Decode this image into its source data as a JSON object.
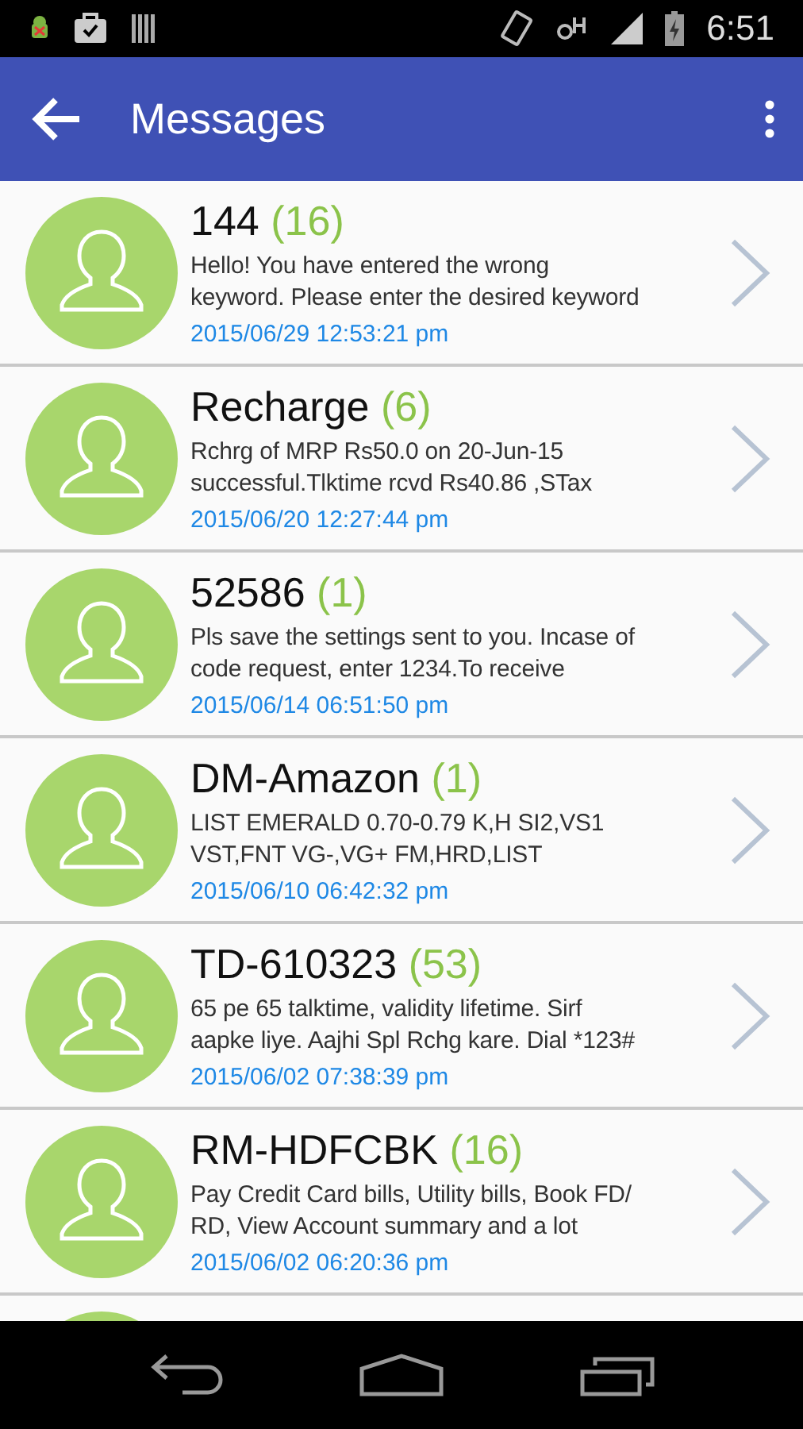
{
  "status_bar": {
    "time": "6:51"
  },
  "app_bar": {
    "title": "Messages"
  },
  "messages": [
    {
      "sender": "144",
      "count": "(16)",
      "preview": "Hello! You have entered the wrong\nkeyword. Please enter the desired keyword",
      "date": "2015/06/29 12:53:21 pm"
    },
    {
      "sender": "Recharge",
      "count": "(6)",
      "preview": "Rchrg of MRP Rs50.0 on 20-Jun-15\nsuccessful.Tlktime rcvd Rs40.86 ,STax",
      "date": "2015/06/20 12:27:44 pm"
    },
    {
      "sender": "52586",
      "count": "(1)",
      "preview": "Pls save the settings sent to you. Incase of\ncode request, enter 1234.To receive",
      "date": "2015/06/14 06:51:50 pm"
    },
    {
      "sender": "DM-Amazon",
      "count": "(1)",
      "preview": "LIST EMERALD 0.70-0.79 K,H SI2,VS1\nVST,FNT VG-,VG+ FM,HRD,LIST",
      "date": "2015/06/10 06:42:32 pm"
    },
    {
      "sender": "TD-610323",
      "count": "(53)",
      "preview": "65 pe 65 talktime, validity lifetime. Sirf\naapke liye. Aajhi Spl Rchg kare. Dial *123#",
      "date": "2015/06/02 07:38:39 pm"
    },
    {
      "sender": "RM-HDFCBK",
      "count": "(16)",
      "preview": "Pay Credit Card bills, Utility bills, Book FD/\nRD, View Account summary and a lot",
      "date": "2015/06/02 06:20:36 pm"
    }
  ]
}
